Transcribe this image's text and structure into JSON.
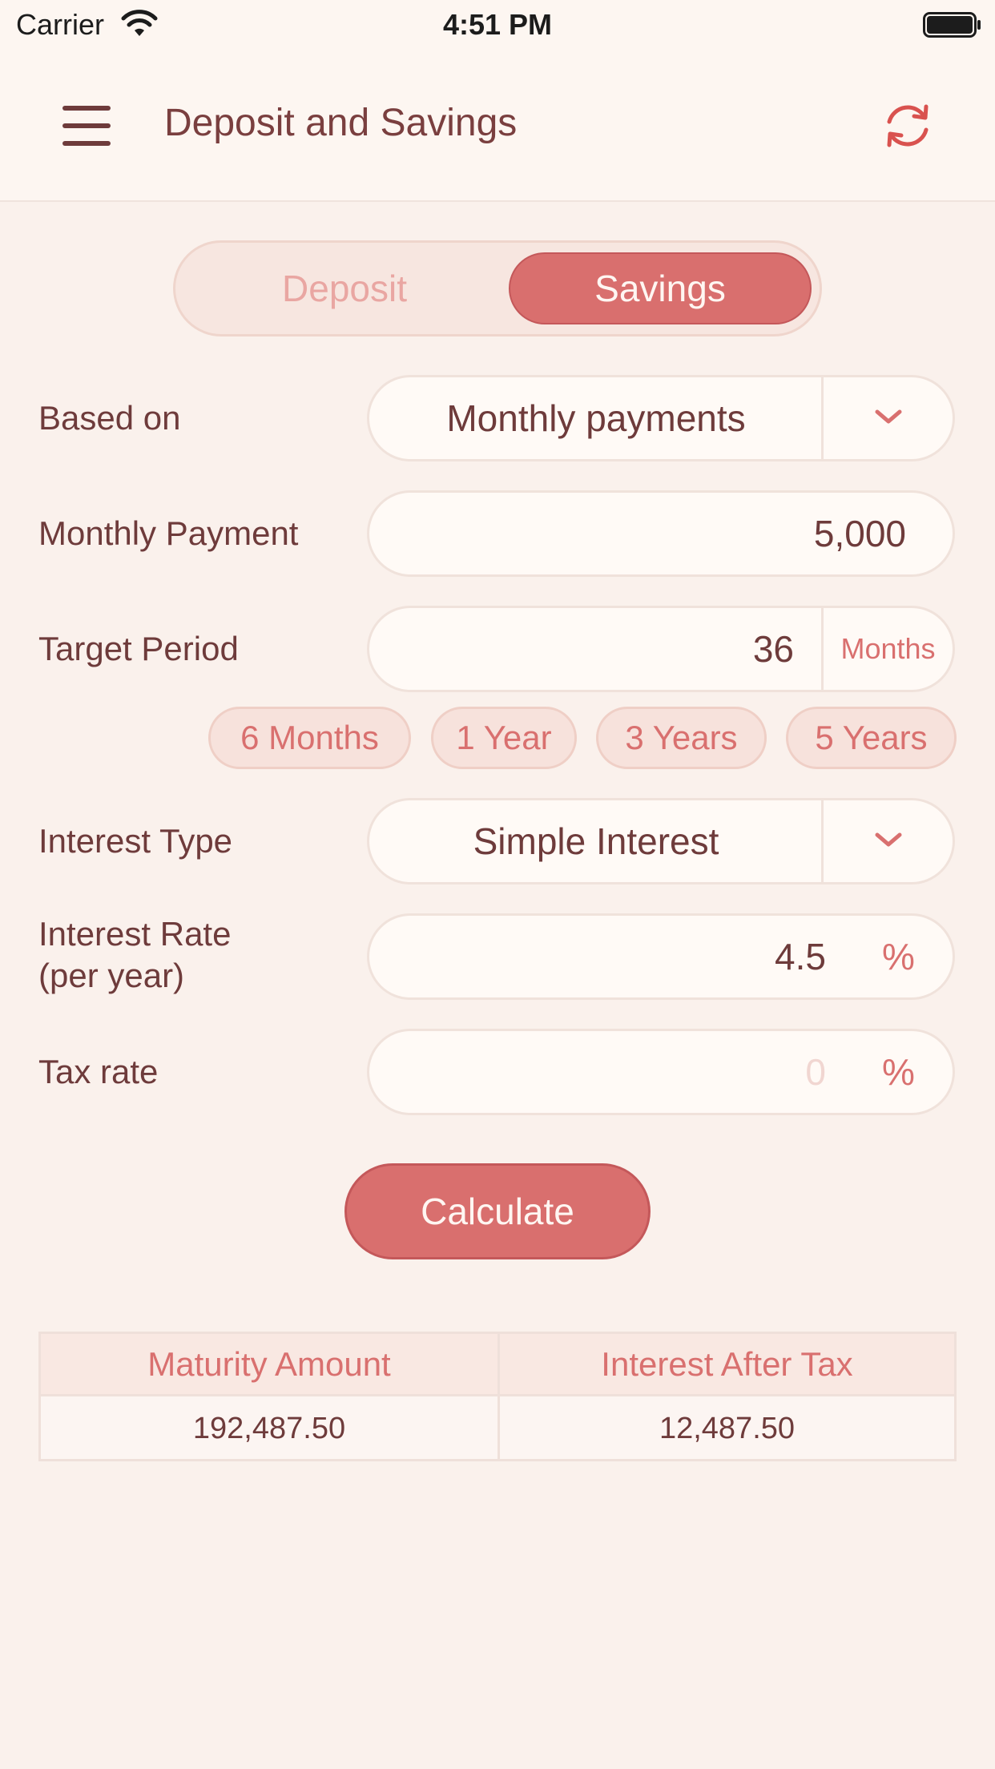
{
  "status_bar": {
    "carrier": "Carrier",
    "time": "4:51 PM"
  },
  "nav": {
    "title": "Deposit and Savings",
    "menu_icon": "hamburger-menu-icon",
    "refresh_icon": "refresh-icon"
  },
  "segment": {
    "options": [
      "Deposit",
      "Savings"
    ],
    "selected": "Savings"
  },
  "form": {
    "based_on": {
      "label": "Based on",
      "value": "Monthly payments"
    },
    "monthly_payment": {
      "label": "Monthly Payment",
      "value": "5,000"
    },
    "target_period": {
      "label": "Target Period",
      "value": "36",
      "unit": "Months"
    },
    "period_chips": [
      "6 Months",
      "1 Year",
      "3 Years",
      "5 Years"
    ],
    "interest_type": {
      "label": "Interest Type",
      "value": "Simple Interest"
    },
    "interest_rate": {
      "label_line1": "Interest Rate",
      "label_line2": "(per year)",
      "value": "4.5",
      "unit": "%"
    },
    "tax_rate": {
      "label": "Tax rate",
      "value": "",
      "placeholder": "0",
      "unit": "%"
    }
  },
  "calculate_label": "Calculate",
  "results": {
    "headers": [
      "Maturity Amount",
      "Interest After Tax"
    ],
    "values": [
      "192,487.50",
      "12,487.50"
    ]
  },
  "colors": {
    "accent": "#d96f6e",
    "text": "#6e3b3b",
    "background": "#faf1ec"
  }
}
